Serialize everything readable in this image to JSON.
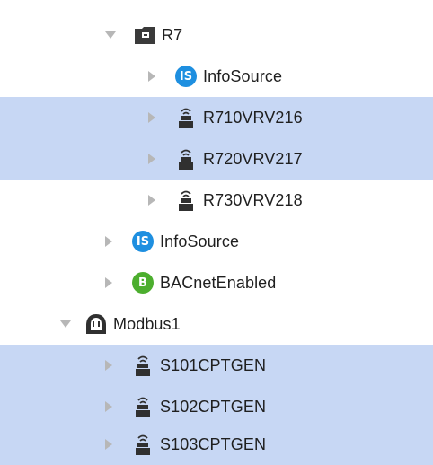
{
  "colors": {
    "selected_row": "#c7d7f4",
    "caret": "#b7b7b7",
    "device_icon": "#303030",
    "infosource_badge": "#1e8fe0",
    "bacnet_badge": "#4cae2e"
  },
  "tree": {
    "items": [
      {
        "label": "R7",
        "icon": "folder-icon",
        "expanded": true,
        "selected": false
      },
      {
        "label": "InfoSource",
        "icon": "infosource-icon",
        "badge_text": "IS",
        "expanded": false,
        "selected": false
      },
      {
        "label": "R710VRV216",
        "icon": "network-device-icon",
        "expanded": false,
        "selected": true
      },
      {
        "label": "R720VRV217",
        "icon": "network-device-icon",
        "expanded": false,
        "selected": true
      },
      {
        "label": "R730VRV218",
        "icon": "network-device-icon",
        "expanded": false,
        "selected": false
      },
      {
        "label": "InfoSource",
        "icon": "infosource-icon",
        "badge_text": "IS",
        "expanded": false,
        "selected": false
      },
      {
        "label": "BACnetEnabled",
        "icon": "bacnet-icon",
        "badge_text": "B",
        "expanded": false,
        "selected": false
      },
      {
        "label": "Modbus1",
        "icon": "modbus-icon",
        "expanded": true,
        "selected": false
      },
      {
        "label": "S101CPTGEN",
        "icon": "network-device-icon",
        "expanded": false,
        "selected": true
      },
      {
        "label": "S102CPTGEN",
        "icon": "network-device-icon",
        "expanded": false,
        "selected": true
      },
      {
        "label": "S103CPTGEN",
        "icon": "network-device-icon",
        "expanded": false,
        "selected": true
      }
    ]
  }
}
